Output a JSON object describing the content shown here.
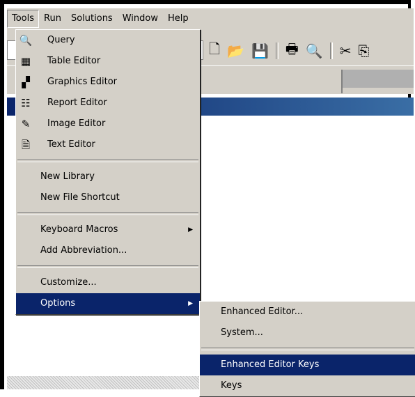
{
  "menubar": {
    "items": [
      "Tools",
      "Run",
      "Solutions",
      "Window",
      "Help"
    ]
  },
  "tools_menu": {
    "items": [
      {
        "label": "Query",
        "icon": "query-icon"
      },
      {
        "label": "Table Editor",
        "icon": "table-editor-icon"
      },
      {
        "label": "Graphics Editor",
        "icon": "graphics-editor-icon"
      },
      {
        "label": "Report Editor",
        "icon": "report-editor-icon"
      },
      {
        "label": "Image Editor",
        "icon": "image-editor-icon"
      },
      {
        "label": "Text Editor",
        "icon": "text-editor-icon"
      }
    ],
    "library": [
      "New Library",
      "New File Shortcut"
    ],
    "macros": [
      "Keyboard Macros",
      "Add Abbreviation..."
    ],
    "custom": [
      "Customize...",
      "Options"
    ]
  },
  "options_submenu": {
    "items": [
      "Enhanced Editor...",
      "System...",
      "Enhanced Editor Keys",
      "Keys"
    ]
  },
  "toolbar": {
    "icons": [
      "new-icon",
      "open-icon",
      "save-icon",
      "print-icon",
      "print-preview-icon",
      "cut-icon",
      "copy-icon"
    ]
  },
  "colors": {
    "face": "#d4d0c8",
    "highlight": "#0a246a",
    "titlebar": "#0a246a"
  }
}
